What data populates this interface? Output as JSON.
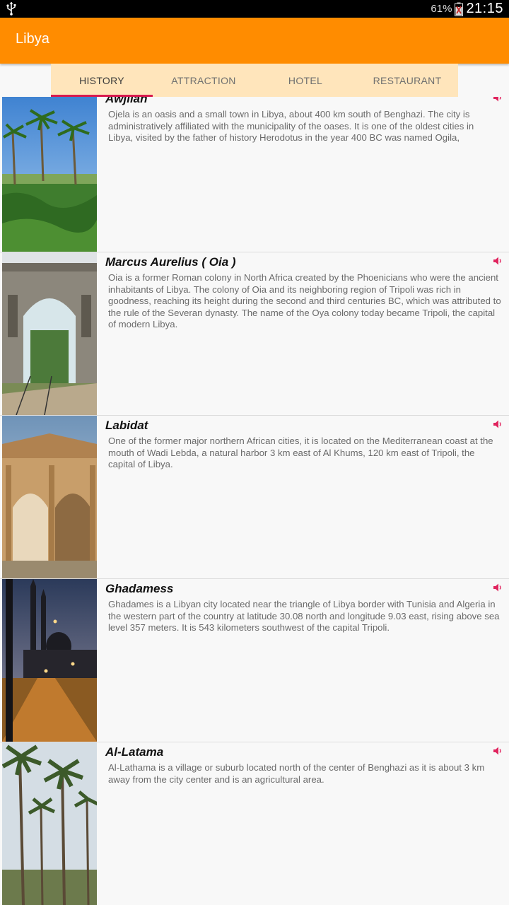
{
  "status_bar": {
    "battery": "61%",
    "time": "21:15"
  },
  "app_bar": {
    "title": "Libya"
  },
  "tabs": [
    {
      "label": "HISTORY",
      "active": true
    },
    {
      "label": "ATTRACTION",
      "active": false
    },
    {
      "label": "HOTEL",
      "active": false
    },
    {
      "label": "RESTAURANT",
      "active": false
    }
  ],
  "colors": {
    "app_bar": "#ff8c00",
    "tab_bar": "#ffe5bb",
    "tab_indicator": "#d81b4f",
    "speaker": "#e0245e"
  },
  "places": [
    {
      "name": "Awjilah",
      "description": "Ojela is an oasis and a small town in Libya, about 400 km south of Benghazi. The city is administratively affiliated with the municipality of the oases. It is one of the oldest cities in Libya, visited by the father of history Herodotus in the year 400 BC was named Ogila,",
      "image": "oasis-palms-photo",
      "icon": "speaker-icon"
    },
    {
      "name": "Marcus Aurelius ( Oia )",
      "description": "Oia is a former Roman colony in North Africa created by the Phoenicians who were the ancient inhabitants of Libya. The colony of Oia and its neighboring region of Tripoli was rich in goodness, reaching its height during the second and third centuries BC, which was attributed to the rule of the Severan dynasty. The name of the Oya colony today became Tripoli, the capital of modern Libya.",
      "image": "arch-photo",
      "icon": "speaker-icon"
    },
    {
      "name": "Labidat",
      "description": "One of the former major northern African cities, it is located on the Mediterranean coast at the mouth of Wadi Lebda, a natural harbor 3 km east of Al Khums, 120 km east of Tripoli, the capital of Libya.",
      "image": "severan-arch-photo",
      "icon": "speaker-icon"
    },
    {
      "name": "Ghadamess",
      "description": "Ghadames is a Libyan city located near the triangle of Libya border with Tunisia and Algeria in the western part of the country at latitude 30.08 north and longitude 9.03 east, rising above sea level 357 meters. It is 543 kilometers southwest of the capital Tripoli.",
      "image": "mosque-night-photo",
      "icon": "speaker-icon"
    },
    {
      "name": "Al-Latama",
      "description": "Al-Lathama is a village or suburb located north of the center of Benghazi as it is about 3 km away from the city center and is an agricultural area.",
      "image": "palm-grove-photo",
      "icon": "speaker-icon"
    }
  ]
}
